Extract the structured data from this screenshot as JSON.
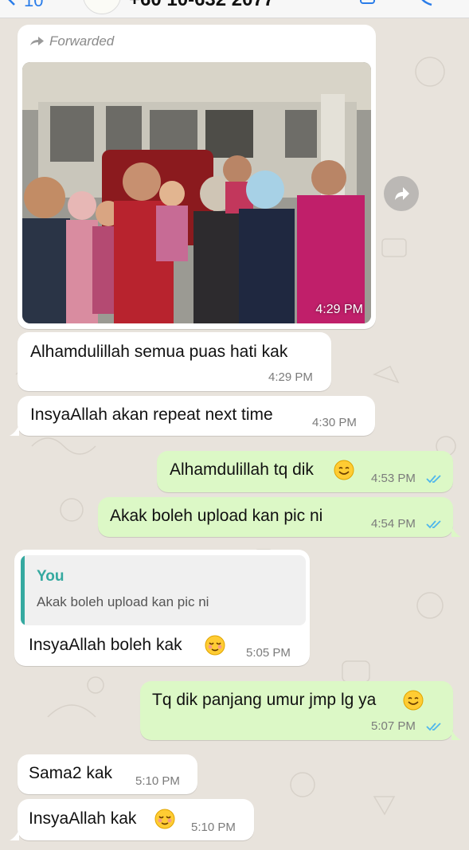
{
  "header": {
    "back_count": "10",
    "contact_title": "+60 10-632 2077"
  },
  "colors": {
    "incoming_bubble": "#ffffff",
    "outgoing_bubble": "#dcf8c6",
    "read_ticks": "#4fb6ec",
    "quote_accent": "#35a9a0"
  },
  "icons": {
    "forward": "forward-arrow-icon",
    "share": "share-icon",
    "ticks": "double-check-icon",
    "smile": "smiling-face-emoji",
    "blush": "relieved-face-emoji"
  },
  "messages": {
    "m0": {
      "forwarded_label": "Forwarded",
      "time": "4:29 PM"
    },
    "m1": {
      "text": "Alhamdulillah semua puas hati kak",
      "time": "4:29 PM"
    },
    "m2": {
      "text": "InsyaAllah akan repeat next time",
      "time": "4:30 PM"
    },
    "m3": {
      "text": "Alhamdulillah tq dik",
      "time": "4:53 PM"
    },
    "m4": {
      "text": "Akak boleh upload kan pic ni",
      "time": "4:54 PM"
    },
    "m5": {
      "quote_author": "You",
      "quote_text": "Akak boleh upload kan pic ni",
      "text": "InsyaAllah boleh kak",
      "time": "5:05 PM"
    },
    "m6": {
      "text": "Tq dik panjang umur jmp lg ya",
      "time": "5:07 PM"
    },
    "m7": {
      "text": "Sama2 kak",
      "time": "5:10 PM"
    },
    "m8": {
      "text": "InsyaAllah kak",
      "time": "5:10 PM"
    }
  }
}
